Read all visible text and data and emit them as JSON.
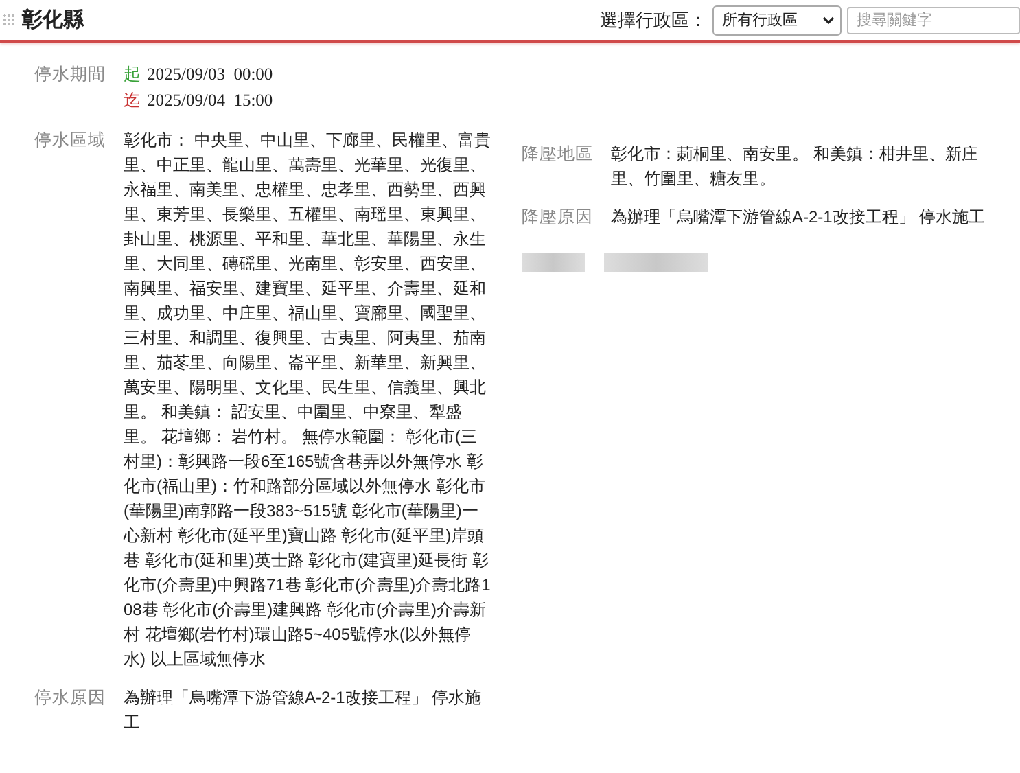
{
  "header": {
    "title": "彰化縣",
    "filter_label": "選擇行政區：",
    "district_select": {
      "value": "所有行政區"
    },
    "search": {
      "placeholder": "搜尋關鍵字"
    }
  },
  "period": {
    "label": "停水期間",
    "entries": [
      {
        "marker": "起",
        "kind": "start",
        "time": "2025/09/03  00:00"
      },
      {
        "marker": "迄",
        "kind": "end",
        "time": "2025/09/04  15:00"
      }
    ]
  },
  "left_fields": [
    {
      "label": "停水區域",
      "value": "彰化市： 中央里、中山里、下廊里、民權里、富貴里、中正里、龍山里、萬壽里、光華里、光復里、永福里、南美里、忠權里、忠孝里、西勢里、西興里、東芳里、長樂里、五權里、南瑶里、東興里、卦山里、桃源里、平和里、華北里、華陽里、永生里、大同里、磚磘里、光南里、彰安里、西安里、南興里、福安里、建寶里、延平里、介壽里、延和里、成功里、中庄里、福山里、寶廍里、國聖里、三村里、和調里、復興里、古夷里、阿夷里、茄南里、茄苳里、向陽里、崙平里、新華里、新興里、萬安里、陽明里、文化里、民生里、信義里、興北里。 和美鎮： 詔安里、中圍里、中寮里、犁盛里。 花壇鄉： 岩竹村。 無停水範圍： 彰化市(三村里)：彰興路一段6至165號含巷弄以外無停水 彰化市(福山里)：竹和路部分區域以外無停水 彰化市(華陽里)南郭路一段383~515號 彰化市(華陽里)一心新村 彰化市(延平里)寶山路 彰化市(延平里)岸頭巷 彰化市(延和里)英士路 彰化市(建寶里)延長街 彰化市(介壽里)中興路71巷 彰化市(介壽里)介壽北路108巷 彰化市(介壽里)建興路 彰化市(介壽里)介壽新村 花壇鄉(岩竹村)環山路5~405號停水(以外無停水) 以上區域無停水"
    },
    {
      "label": "停水原因",
      "value": "為辦理「烏嘴潭下游管線A-2-1改接工程」 停水施工"
    }
  ],
  "right_fields": [
    {
      "label": "降壓地區",
      "value": "彰化市：莿桐里、南安里。 和美鎮：柑井里、新庄里、竹圍里、糖友里。"
    },
    {
      "label": "降壓原因",
      "value": "為辦理「烏嘴潭下游管線A-2-1改接工程」 停水施工"
    }
  ]
}
